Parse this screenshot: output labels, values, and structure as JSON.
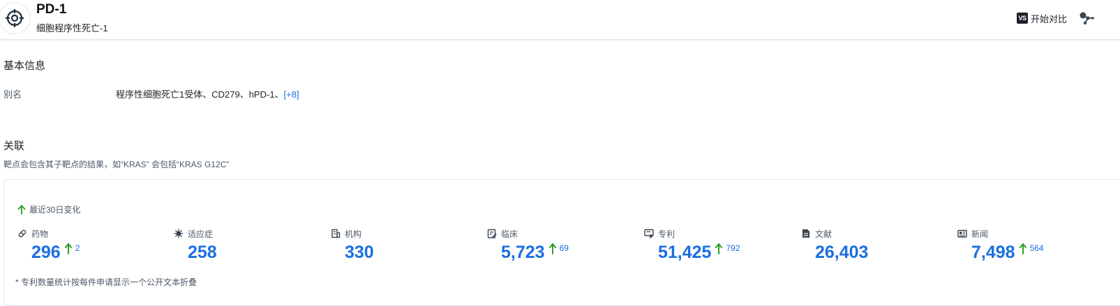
{
  "header": {
    "title": "PD-1",
    "subtitle": "细胞程序性死亡-1",
    "compare_badge": "VS",
    "compare_label": "开始对比"
  },
  "basic_info": {
    "section_title": "基本信息",
    "alias_label": "别名",
    "alias_value": "程序性细胞死亡1受体、CD279、hPD-1、",
    "alias_more": "[+8]"
  },
  "association": {
    "section_title": "关联",
    "description": "靶点会包含其子靶点的结果，如“KRAS” 会包括“KRAS G12C”",
    "change_label": "最近30日变化",
    "accent_color": "#1a6fe0",
    "up_color": "#2e9e1f",
    "stats": [
      {
        "icon": "pill-icon",
        "label": "药物",
        "value": "296",
        "delta": "2"
      },
      {
        "icon": "virus-icon",
        "label": "适应症",
        "value": "258",
        "delta": ""
      },
      {
        "icon": "building-icon",
        "label": "机构",
        "value": "330",
        "delta": ""
      },
      {
        "icon": "clinical-icon",
        "label": "临床",
        "value": "5,723",
        "delta": "69"
      },
      {
        "icon": "patent-icon",
        "label": "专利",
        "value": "51,425",
        "delta": "792"
      },
      {
        "icon": "document-icon",
        "label": "文献",
        "value": "26,403",
        "delta": ""
      },
      {
        "icon": "news-icon",
        "label": "新闻",
        "value": "7,498",
        "delta": "564"
      }
    ],
    "footnote": "* 专利数量统计按每件申请显示一个公开文本折叠"
  }
}
